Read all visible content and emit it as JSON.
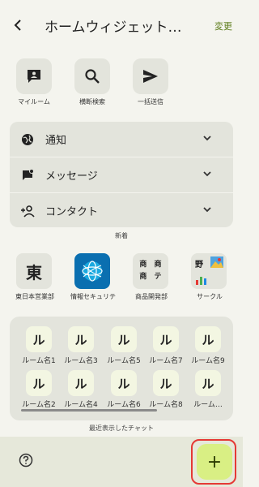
{
  "header": {
    "title": "ホームウィジェット…",
    "edit_label": "変更"
  },
  "quick_actions": [
    {
      "label": "マイルーム",
      "icon": "chat-bubble-person-icon"
    },
    {
      "label": "横断検索",
      "icon": "search-icon"
    },
    {
      "label": "一括送信",
      "icon": "send-icon"
    }
  ],
  "accordion": [
    {
      "label": "通知",
      "icon": "globe-icon"
    },
    {
      "label": "メッセージ",
      "icon": "flag-message-icon"
    },
    {
      "label": "コンタクト",
      "icon": "person-add-icon"
    }
  ],
  "section_new": "新着",
  "apps": [
    {
      "label": "東日本営業部",
      "glyph": "東"
    },
    {
      "label": "情報セキュリテ",
      "glyph": ""
    },
    {
      "label": "商品開発部",
      "glyph": "商 商 商 テ"
    },
    {
      "label": "サークル",
      "glyph": "野"
    }
  ],
  "rooms": [
    {
      "glyph": "ル",
      "label": "ルーム名1"
    },
    {
      "glyph": "ル",
      "label": "ルーム名3"
    },
    {
      "glyph": "ル",
      "label": "ルーム名5"
    },
    {
      "glyph": "ル",
      "label": "ルーム名7"
    },
    {
      "glyph": "ル",
      "label": "ルーム名9"
    },
    {
      "glyph": "ル",
      "label": "ルーム名2"
    },
    {
      "glyph": "ル",
      "label": "ルーム名4"
    },
    {
      "glyph": "ル",
      "label": "ルーム名6"
    },
    {
      "glyph": "ル",
      "label": "ルーム名8"
    },
    {
      "glyph": "ル",
      "label": "ルーム…"
    }
  ],
  "section_recent": "最近表示したチャット",
  "fab_label": "+",
  "colors": {
    "accent": "#5c7c1a",
    "fab": "#d9ef84",
    "highlight": "#e53935"
  }
}
